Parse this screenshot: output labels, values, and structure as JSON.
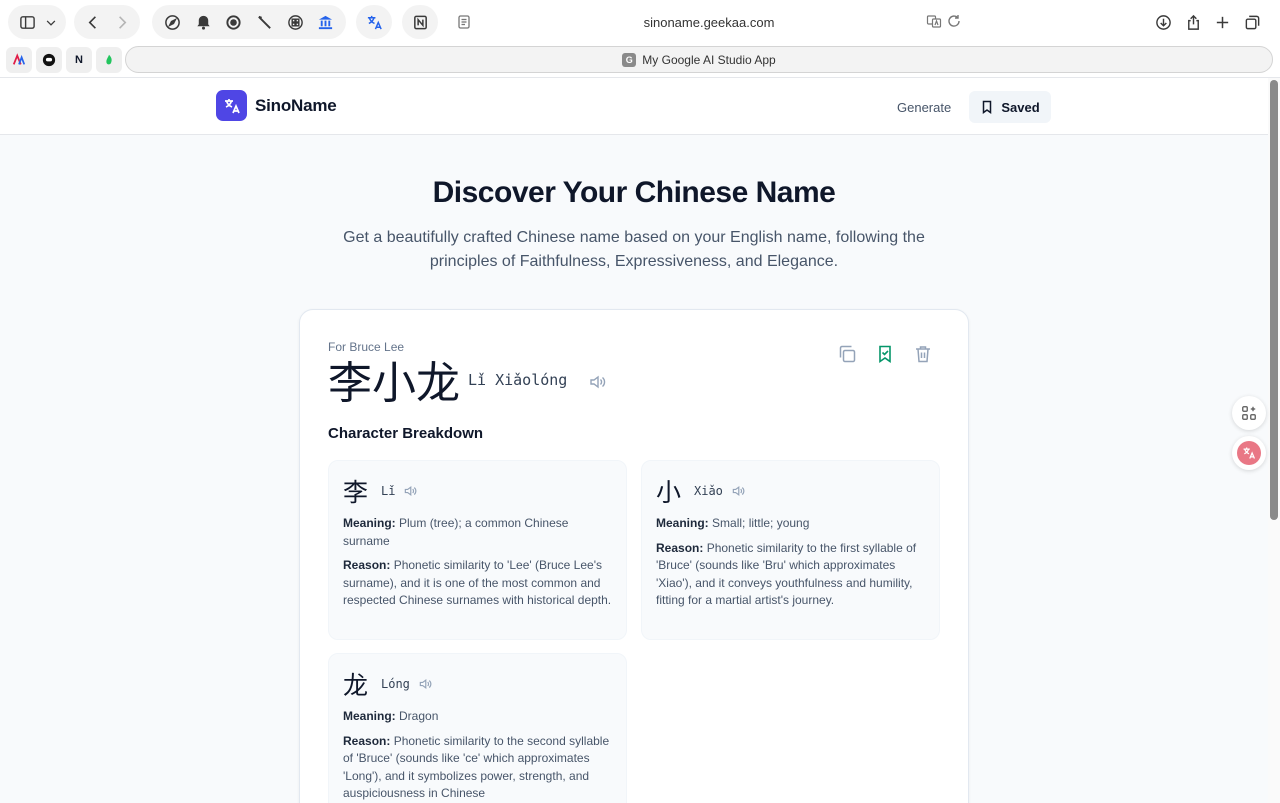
{
  "browser": {
    "url": "sinoname.geekaa.com",
    "tab_title": "My Google AI Studio App",
    "tab_favicon_letter": "G",
    "favicons": [
      {
        "name": "favicon-ai",
        "label": ""
      },
      {
        "name": "favicon-chat",
        "label": ""
      },
      {
        "name": "favicon-notion",
        "label": "N"
      },
      {
        "name": "favicon-leaf",
        "label": ""
      }
    ]
  },
  "header": {
    "brand": "SinoName",
    "nav_generate": "Generate",
    "nav_saved": "Saved"
  },
  "hero": {
    "title": "Discover Your Chinese Name",
    "subtitle": "Get a beautifully crafted Chinese name based on your English name, following the principles of Faithfulness, Expressiveness, and Elegance."
  },
  "result": {
    "for_label": "For Bruce Lee",
    "chinese_name": "李小龙",
    "pinyin": "Lǐ Xiǎolóng",
    "section_title": "Character Breakdown",
    "meaning_label": "Meaning:",
    "reason_label": "Reason:",
    "characters": [
      {
        "char": "李",
        "pinyin": "Lǐ",
        "meaning": "Plum (tree); a common Chinese surname",
        "reason": "Phonetic similarity to 'Lee' (Bruce Lee's surname), and it is one of the most common and respected Chinese surnames with historical depth."
      },
      {
        "char": "小",
        "pinyin": "Xiǎo",
        "meaning": "Small; little; young",
        "reason": "Phonetic similarity to the first syllable of 'Bruce' (sounds like 'Bru' which approximates 'Xiao'), and it conveys youthfulness and humility, fitting for a martial artist's journey."
      },
      {
        "char": "龙",
        "pinyin": "Lóng",
        "meaning": "Dragon",
        "reason": "Phonetic similarity to the second syllable of 'Bruce' (sounds like 'ce' which approximates 'Long'), and it symbolizes power, strength, and auspiciousness in Chinese"
      }
    ]
  },
  "colors": {
    "accent": "#4f46e5",
    "saved_green": "#059669",
    "text_dark": "#0f172a",
    "text_muted": "#475569"
  },
  "icons": {
    "logo": "translate-icon",
    "copy": "copy-icon",
    "bookmark": "bookmark-check-icon",
    "delete": "trash-icon",
    "speak": "speaker-icon"
  }
}
